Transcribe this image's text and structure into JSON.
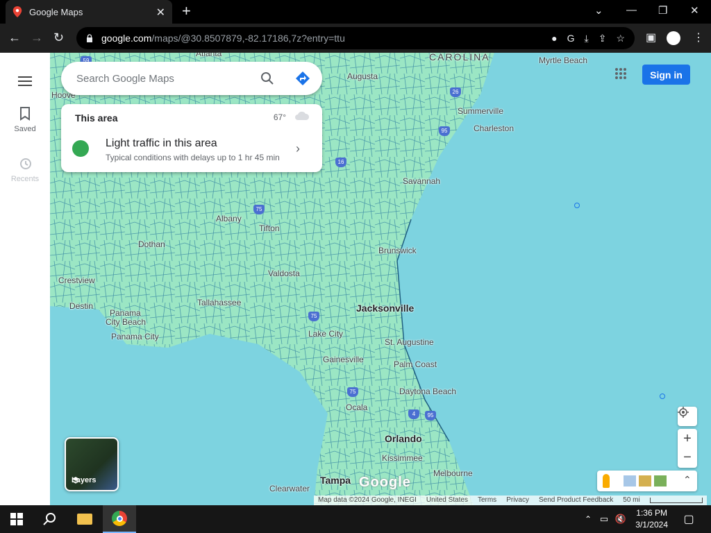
{
  "browser": {
    "tab_title": "Google Maps",
    "url_host": "google.com",
    "url_rest": "/maps/@30.8507879,-82.17186,7z?entry=ttu"
  },
  "rail": {
    "saved_label": "Saved",
    "recents_label": "Recents"
  },
  "search": {
    "placeholder": "Search Google Maps"
  },
  "area_card": {
    "title": "This area",
    "temperature": "67°",
    "traffic_title": "Light traffic in this area",
    "traffic_subtitle": "Typical conditions with delays up to 1 hr 45 min"
  },
  "header": {
    "sign_in_label": "Sign in"
  },
  "map": {
    "cities": [
      {
        "name": "Atlanta"
      },
      {
        "name": "CAROLINA"
      },
      {
        "name": "Myrtle Beach"
      },
      {
        "name": "Augusta"
      },
      {
        "name": "Summerville"
      },
      {
        "name": "Charleston"
      },
      {
        "name": "Savannah"
      },
      {
        "name": "Albany"
      },
      {
        "name": "Tifton"
      },
      {
        "name": "Dothan"
      },
      {
        "name": "Brunswick"
      },
      {
        "name": "Valdosta"
      },
      {
        "name": "Crestview"
      },
      {
        "name": "Destin"
      },
      {
        "name": "Panama"
      },
      {
        "name": "City Beach"
      },
      {
        "name": "Panama City"
      },
      {
        "name": "Tallahassee"
      },
      {
        "name": "Jacksonville"
      },
      {
        "name": "Lake City"
      },
      {
        "name": "St. Augustine"
      },
      {
        "name": "Gainesville"
      },
      {
        "name": "Palm Coast"
      },
      {
        "name": "Daytona Beach"
      },
      {
        "name": "Ocala"
      },
      {
        "name": "Orlando"
      },
      {
        "name": "Kissimmee"
      },
      {
        "name": "Melbourne"
      },
      {
        "name": "Tampa"
      },
      {
        "name": "Clearwater"
      },
      {
        "name": "Hoove"
      }
    ],
    "highways": [
      "26",
      "95",
      "16",
      "75",
      "75",
      "75",
      "4",
      "95",
      "59"
    ],
    "layers_label": "Layers",
    "logo_text": "Google"
  },
  "footer": {
    "map_data": "Map data ©2024 Google, INEGI",
    "country": "United States",
    "terms": "Terms",
    "privacy": "Privacy",
    "feedback": "Send Product Feedback",
    "scale": "50 mi"
  },
  "taskbar": {
    "time": "1:36 PM",
    "date": "3/1/2024"
  },
  "colors": {
    "water": "#7dd3e0",
    "land": "#9be6c4",
    "roads": "#2f7fa0",
    "accent": "#1a73e8"
  }
}
